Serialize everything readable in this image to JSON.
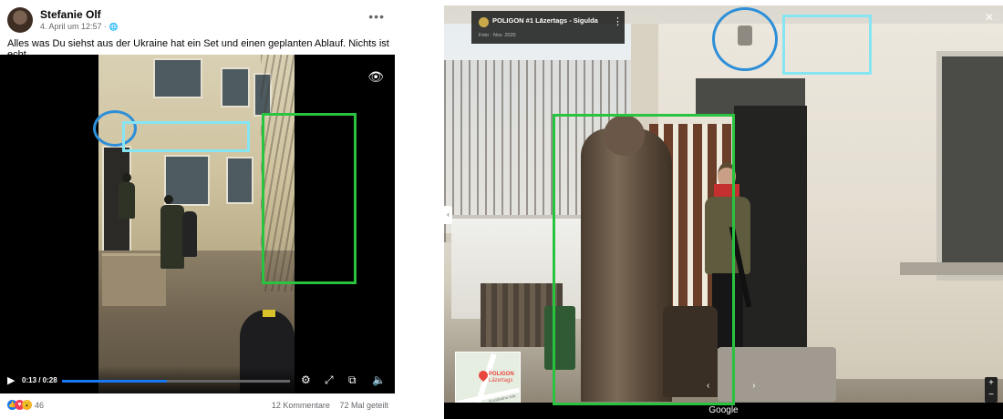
{
  "facebook_post": {
    "author": "Stefanie Olf",
    "date": "4. April um 12:57 · ",
    "globe_glyph": "🌐",
    "more_glyph": "•••",
    "caption": "Alles was Du siehst aus der Ukraine hat ein Set und einen geplanten Ablauf. Nichts ist echt",
    "video": {
      "timecode": "0:13 / 0:28",
      "progress_fraction": 0.46,
      "play_glyph": "▶",
      "eye_glyph": "👁",
      "settings_glyph": "⚙",
      "fullscreen_glyph": "⤢",
      "pip_glyph": "⧉",
      "volume_glyph": "🔈"
    },
    "reactions_count": "46",
    "comments": "12 Kommentare",
    "shares": "72 Mal geteilt",
    "reaction_icons": [
      "like-icon",
      "love-icon",
      "wow-icon"
    ]
  },
  "street_view": {
    "title": "POLIGON #1 Lāzertags - Sigulda",
    "subtitle": "Foto · Nov. 2020",
    "dots_glyph": "⋮",
    "close_glyph": "✕",
    "collapse_glyph": "‹",
    "nav_glyphs": "‹ ›",
    "zoom_plus": "+",
    "zoom_minus": "−",
    "footer": "Google",
    "minimap": {
      "label_line1": "POLIGON",
      "label_line2": "Lāzertags",
      "street": "Krustkalnu iela"
    }
  },
  "colors": {
    "circle": "#2d8fd8",
    "cyan_box": "#86e5f2",
    "green_box": "#29c33f",
    "facebook_blue": "#1877f2"
  }
}
